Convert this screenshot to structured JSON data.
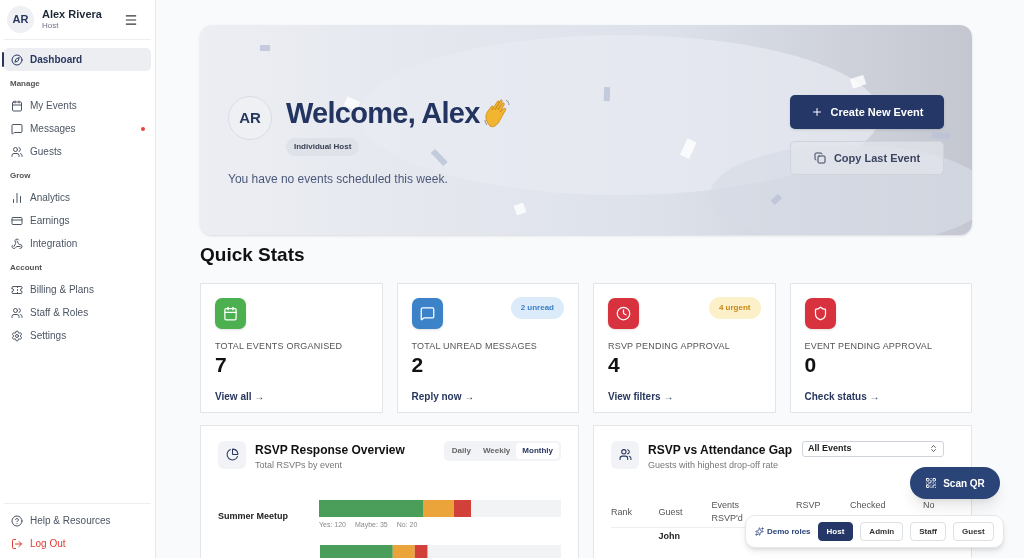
{
  "sidebar": {
    "user": {
      "initials": "AR",
      "name": "Alex Rivera",
      "role": "Host"
    },
    "sections": [
      {
        "items": [
          {
            "label": "Dashboard",
            "kind": "compass",
            "selected": true,
            "unread": false
          }
        ]
      },
      {
        "heading": "Manage",
        "items": [
          {
            "label": "My Events",
            "kind": "calendar",
            "selected": false,
            "unread": false
          },
          {
            "label": "Messages",
            "kind": "message",
            "selected": false,
            "unread": true
          },
          {
            "label": "Guests",
            "kind": "users",
            "selected": false,
            "unread": false
          }
        ]
      },
      {
        "heading": "Grow",
        "items": [
          {
            "label": "Analytics",
            "kind": "chart",
            "selected": false,
            "unread": false
          },
          {
            "label": "Earnings",
            "kind": "card",
            "selected": false,
            "unread": false
          },
          {
            "label": "Integration",
            "kind": "webhook",
            "selected": false,
            "unread": false
          }
        ]
      },
      {
        "heading": "Account",
        "items": [
          {
            "label": "Billing & Plans",
            "kind": "ticket",
            "selected": false,
            "unread": false
          },
          {
            "label": "Staff & Roles",
            "kind": "users",
            "selected": false,
            "unread": false
          },
          {
            "label": "Settings",
            "kind": "gear",
            "selected": false,
            "unread": false
          }
        ]
      }
    ],
    "footer": [
      {
        "label": "Help & Resources",
        "kind": "help"
      },
      {
        "label": "Log Out",
        "kind": "logout"
      }
    ]
  },
  "hero": {
    "initials": "AR",
    "title": "Welcome, Alex",
    "badge": "Individual Host",
    "subtitle": "You have no events scheduled this week.",
    "buttons": [
      {
        "label": "Create New Event",
        "kind": "primary"
      },
      {
        "label": "Copy Last Event",
        "kind": "secondary"
      }
    ]
  },
  "quick_stats": {
    "title": "Quick Stats",
    "cards": [
      {
        "label": "TOTAL EVENTS ORGANISED",
        "value": "7",
        "link": "View all →",
        "kind": "calendar",
        "color": "#4caf50"
      },
      {
        "label": "TOTAL UNREAD MESSAGES",
        "value": "2",
        "link": "Reply now →",
        "kind": "message",
        "color": "#3b82c8",
        "tag": {
          "text": "2 unread",
          "kind": "info"
        }
      },
      {
        "label": "RSVP PENDING APPROVAL",
        "value": "4",
        "link": "View filters →",
        "kind": "clock",
        "color": "#d9323f",
        "tag": {
          "text": "4 urgent",
          "kind": "warning"
        }
      },
      {
        "label": "EVENT PENDING APPROVAL",
        "value": "0",
        "link": "Check status →",
        "kind": "shield",
        "color": "#d9323f"
      }
    ]
  },
  "rsvp_overview": {
    "title": "RSVP Response Overview",
    "subtitle": "Total RSVPs by event",
    "periods": [
      {
        "label": "Daily",
        "selected": false
      },
      {
        "label": "Weekly",
        "selected": false
      },
      {
        "label": "Monthly",
        "selected": true
      }
    ],
    "rows": [
      {
        "name": "Summer Meetup",
        "counts": [
          "Yes: 120",
          "Maybe: 35",
          "No: 20"
        ]
      }
    ]
  },
  "attendance_gap": {
    "title": "RSVP vs Attendance Gap",
    "subtitle": "Guests with highest drop-off rate",
    "filter": "All Events",
    "columns": [
      "Rank",
      "Guest",
      "Events RSVP'd",
      "RSVP",
      "Checked",
      "No"
    ],
    "rows": [
      [
        "",
        "John"
      ]
    ]
  },
  "scan_button": {
    "label": "Scan QR"
  },
  "demo_roles": {
    "label": "Demo roles",
    "roles": [
      {
        "label": "Host",
        "selected": true
      },
      {
        "label": "Admin",
        "selected": false
      },
      {
        "label": "Staff",
        "selected": false
      },
      {
        "label": "Guest",
        "selected": false
      }
    ]
  }
}
